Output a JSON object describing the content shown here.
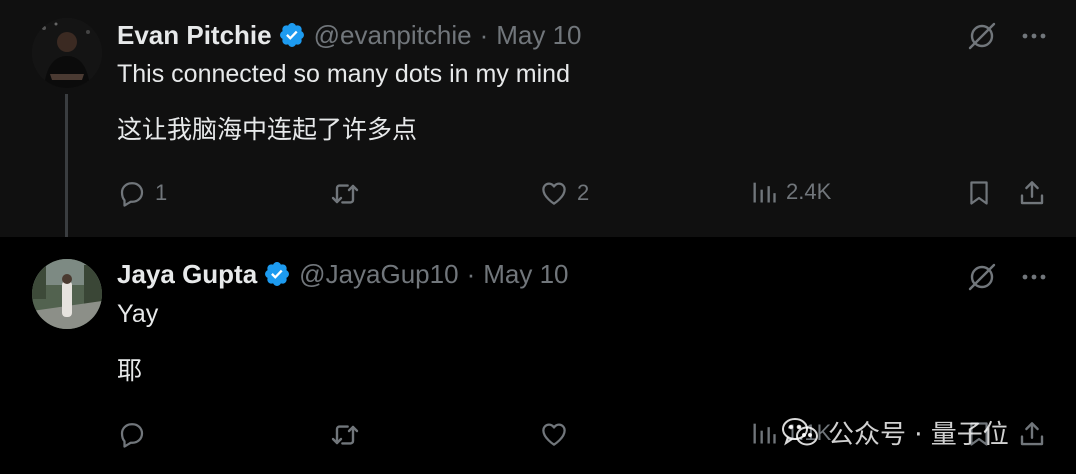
{
  "tweets": [
    {
      "name": "Evan Pitchie",
      "handle": "@evanpitchie",
      "separator": "·",
      "date": "May 10",
      "text_en": "This connected so many dots in my mind",
      "text_zh": "这让我脑海中连起了许多点",
      "replies": "1",
      "retweets": "",
      "likes": "2",
      "views": "2.4K"
    },
    {
      "name": "Jaya Gupta",
      "handle": "@JayaGup10",
      "separator": "·",
      "date": "May 10",
      "text_en": "Yay",
      "text_zh": "耶",
      "replies": "",
      "retweets": "",
      "likes": "",
      "views": "1.1K"
    }
  ],
  "watermark": {
    "text": "公众号 · 量子位"
  },
  "icons": {
    "reply": "reply-icon",
    "retweet": "retweet-icon",
    "like": "like-icon",
    "views": "views-icon",
    "bookmark": "bookmark-icon",
    "share": "share-icon",
    "grok": "grok-icon",
    "more": "more-icon",
    "verified": "verified-badge-icon",
    "wechat": "wechat-icon"
  },
  "colors": {
    "background": "#000000",
    "highlight_background": "#101010",
    "text": "#e7e9ea",
    "secondary": "#71767b",
    "verified": "#1d9bf0"
  }
}
